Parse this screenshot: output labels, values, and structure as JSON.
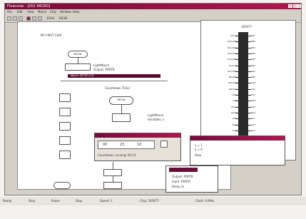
{
  "window": {
    "title": "Flowcode - [001 MICRO]",
    "menus": [
      "File",
      "Edit",
      "View",
      "Macro",
      "Chip",
      "Window",
      "Help"
    ]
  },
  "toolbar": {
    "zoom_label": "100%",
    "chip_label": "16F84"
  },
  "flowchart": {
    "main_title": "MY FIRST CHIP",
    "begin_label": "BEGIN",
    "loop_label": "LightMacro",
    "loop_sub": "Output: PORTB",
    "highlight_bar": "Macro: SETUP LCD",
    "second_title": "Countdown Timer",
    "begin2_label": "BEGIN",
    "call_label": "LightMacro",
    "call_sub": "Variables: x"
  },
  "pin_panel": {
    "title": "16F877",
    "left_pins": [
      "MCLR",
      "RA0/AN0",
      "RA1/AN1",
      "RA2/AN2",
      "RA3/AN3",
      "RA4/T0",
      "RA5/AN4",
      "RE0/RD",
      "RE1/WR",
      "RE2/CS",
      "VDD",
      "VSS",
      "OSC1",
      "OSC2",
      "RC0",
      "RC1",
      "RC2",
      "RC3",
      "RD0",
      "RD1"
    ],
    "right_pins": [
      "RB7",
      "RB6",
      "RB5",
      "RB4",
      "RB3",
      "RB2",
      "RB1",
      "RB0",
      "VDD",
      "VSS",
      "RD7",
      "RD6",
      "RD5",
      "RD4",
      "RC7",
      "RC6",
      "RC5",
      "RC4",
      "RD3",
      "RD2"
    ]
  },
  "dialog_time": {
    "title": "Timer",
    "values": [
      "00",
      "23",
      "10"
    ],
    "footer": "Countdown running: 00:23"
  },
  "dialog_vars": {
    "title": "Variables",
    "items": [
      "x = 1",
      "y = 0",
      "Stop"
    ]
  },
  "dialog_bottom": {
    "lines": [
      "Output: PORTB",
      "Input: PORTA",
      "Delay 1s"
    ]
  },
  "statusbar": {
    "items": [
      "Ready",
      "Step",
      "Pause",
      "Stop",
      "Speed: 1",
      "Chip: 16F877",
      "Clock: 4 MHz"
    ]
  }
}
